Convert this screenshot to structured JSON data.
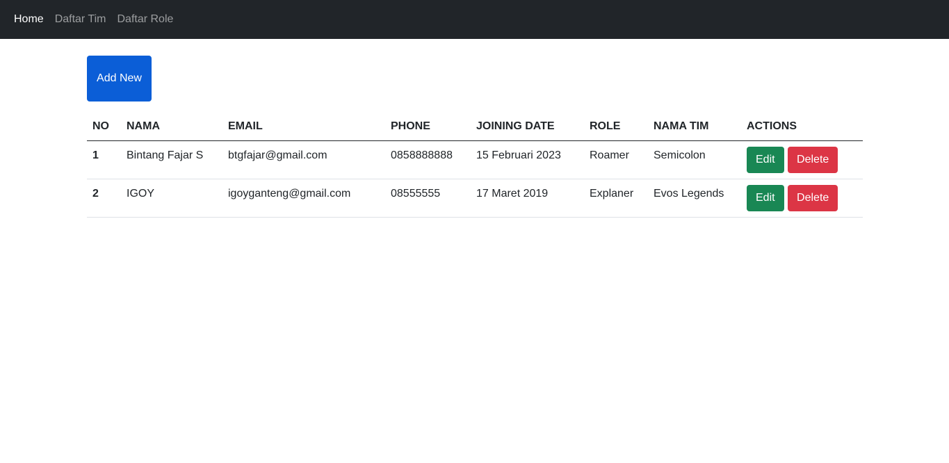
{
  "nav": {
    "items": [
      {
        "label": "Home",
        "active": true
      },
      {
        "label": "Daftar Tim",
        "active": false
      },
      {
        "label": "Daftar Role",
        "active": false
      }
    ]
  },
  "toolbar": {
    "add_label": "Add New"
  },
  "table": {
    "headers": [
      "NO",
      "NAMA",
      "EMAIL",
      "PHONE",
      "JOINING DATE",
      "ROLE",
      "NAMA TIM",
      "ACTIONS"
    ],
    "rows": [
      {
        "no": "1",
        "nama": "Bintang Fajar S",
        "email": "btgfajar@gmail.com",
        "phone": "0858888888",
        "joining_date": "15 Februari 2023",
        "role": "Roamer",
        "nama_tim": "Semicolon",
        "edit_label": "Edit",
        "delete_label": "Delete"
      },
      {
        "no": "2",
        "nama": "IGOY",
        "email": "igoyganteng@gmail.com",
        "phone": "08555555",
        "joining_date": "17 Maret 2019",
        "role": "Explaner",
        "nama_tim": "Evos Legends",
        "edit_label": "Edit",
        "delete_label": "Delete"
      }
    ]
  },
  "colors": {
    "navbar_bg": "#212529",
    "primary": "#0b5ed7",
    "success": "#198754",
    "danger": "#dc3545"
  }
}
